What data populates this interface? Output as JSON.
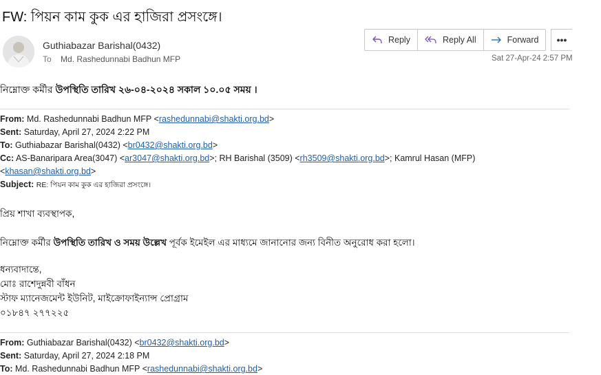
{
  "subject": "FW: পিয়ন কাম কুক এর হাজিরা প্রসংঙ্গে।",
  "sender": {
    "name": "Guthiabazar Barishal(0432)",
    "to_label": "To",
    "to": "Md. Rashedunnabi Badhun MFP"
  },
  "actions": {
    "reply": "Reply",
    "reply_all": "Reply All",
    "forward": "Forward",
    "more": "•••"
  },
  "date": "Sat 27-Apr-24 2:57 PM",
  "body": {
    "intro_prefix": "নিম্নোক্ত কর্মীর ",
    "intro_bold": "উপস্থিতি তারিখ ২৬-০৪-২০২৪ সকাল ১০.০৫ সময় ।",
    "fwd1": {
      "from_label": "From:",
      "from_name": "Md. Rashedunnabi Badhun MFP <",
      "from_email": "rashedunnabi@shakti.org.bd",
      "from_end": ">",
      "sent_label": "Sent:",
      "sent": "Saturday, April 27, 2024 2:22 PM",
      "to_label": "To:",
      "to_name": "Guthiabazar Barishal(0432) <",
      "to_email": "br0432@shakti.org.bd",
      "to_end": ">",
      "cc_label": "Cc:",
      "cc_a": "AS-Banaripara Area(3047) <",
      "cc_a_email": "ar3047@shakti.org.bd",
      "cc_b": ">; RH Barishal (3509) <",
      "cc_b_email": "rh3509@shakti.org.bd",
      "cc_c": ">; Kamrul Hasan (MFP)",
      "cc_c_open": "<",
      "cc_c_email": "khasan@shakti.org.bd",
      "cc_c_end": ">",
      "subject_label": "Subject:",
      "subject": "RE: পিয়ন কাম কুক এর হাজিরা প্রসংঙ্গে।"
    },
    "greeting": "প্রিয় শাখা ব্যবস্থাপক,",
    "main_prefix": "নিম্নোক্ত কর্মীর ",
    "main_bold": "উপস্থিতি তারিখ ও সময় উল্লেখ",
    "main_suffix": " পূর্বক ইমেইল এর মাধ্যমে জানানোর জন্য বিনীত অনুরোধ করা হলো।",
    "signature": [
      "ধন্যবাদান্তে,",
      "মোঃ রাশেদুন্নবী বাঁধন",
      "স্টাফ ম্যানেজমেন্ট ইউনিট, মাইক্রোফাইন্যান্স প্রোগ্রাম",
      "০১৮৪৭ ২৭৭২২৫"
    ],
    "fwd2": {
      "from_label": "From:",
      "from_name": "Guthiabazar Barishal(0432) <",
      "from_email": "br0432@shakti.org.bd",
      "from_end": ">",
      "sent_label": "Sent:",
      "sent": "Saturday, April 27, 2024 2:18 PM",
      "to_label": "To:",
      "to_name": "Md. Rashedunnabi Badhun MFP <",
      "to_email": "rashedunnabi@shakti.org.bd",
      "to_end": ">"
    }
  }
}
